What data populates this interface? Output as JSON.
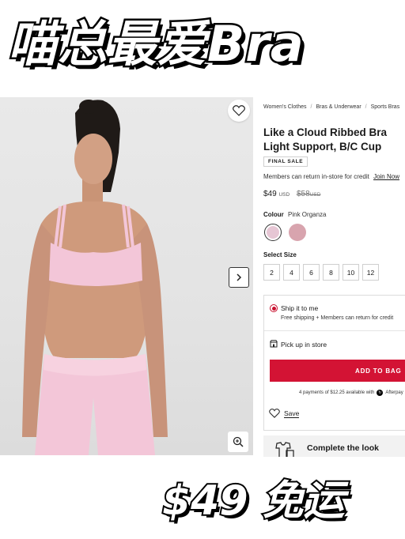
{
  "banner": {
    "top_title": "喵总最爱Bra",
    "bottom_promo": "$49 免运"
  },
  "gallery": {
    "favorite_icon": "heart-outline-icon",
    "next_icon": "chevron-right-icon",
    "zoom_icon": "zoom-in-icon",
    "product_color": "#f3c6d8",
    "background_color": "#e6e6e6"
  },
  "breadcrumb": [
    "Women's Clothes",
    "Bras & Underwear",
    "Sports Bras"
  ],
  "product": {
    "title": "Like a Cloud Ribbed Bra Light Support, B/C Cup",
    "badge": "FINAL SALE",
    "members_note": "Members can return in-store for credit",
    "join_link": "Join Now",
    "price": "$49",
    "price_currency": "USD",
    "old_price": "$58",
    "old_price_currency": "USD",
    "colour_label": "Colour",
    "colour_value": "Pink Organza",
    "swatches": [
      "#e6c6d4",
      "#d8a4ae"
    ],
    "size_label": "Select Size",
    "sizes": [
      "2",
      "4",
      "6",
      "8",
      "10",
      "12"
    ]
  },
  "shipping": {
    "ship_title": "Ship it to me",
    "ship_sub": "Free shipping + Members can return for credit",
    "pickup_title": "Pick up in store",
    "add_to_bag": "ADD TO BAG",
    "installments": "4 payments of $12.25 available with",
    "installments_brand": "Afterpay",
    "save_label": "Save",
    "accent_color": "#d31334"
  },
  "complete_look": {
    "title": "Complete the look"
  }
}
